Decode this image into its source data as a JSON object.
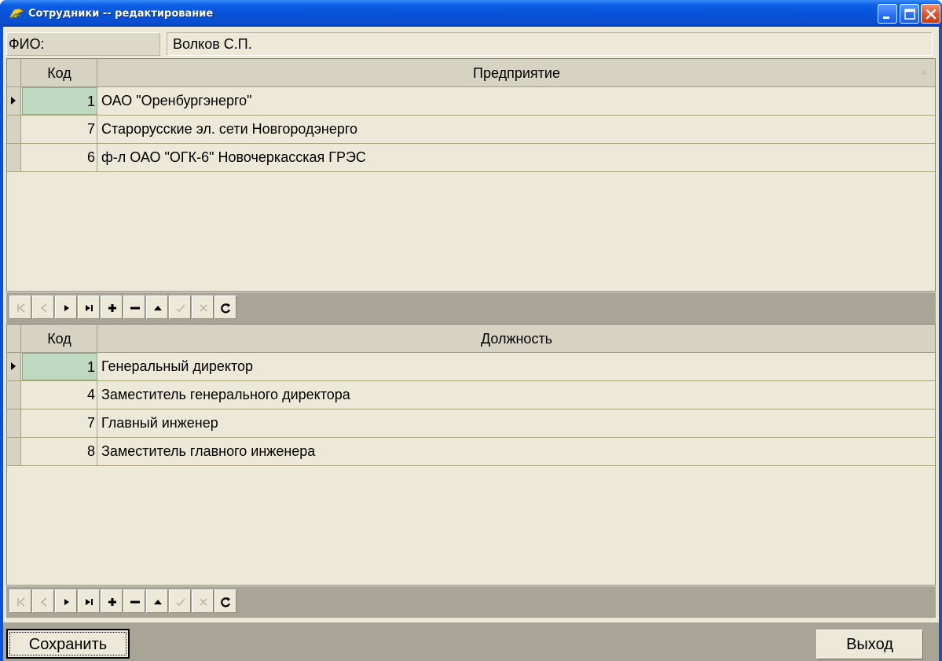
{
  "window": {
    "title": "Сотрудники -- редактирование",
    "colors": {
      "titlebar": "#0853d8",
      "client": "#ece9d8",
      "selected_cell": "#bfd9c0",
      "nav_bar": "#a8a596"
    }
  },
  "fio": {
    "label": "ФИО:",
    "value": "Волков С.П."
  },
  "enterprises": {
    "columns": {
      "code": "Код",
      "name": "Предприятие"
    },
    "rows": [
      {
        "code": "1",
        "name": "ОАО \"Оренбургэнерго\""
      },
      {
        "code": "7",
        "name": "Старорусские эл. сети Новгородэнерго"
      },
      {
        "code": "6",
        "name": "ф-л ОАО \"ОГК-6\" Новочеркасская ГРЭС"
      }
    ],
    "selected_row": 0
  },
  "positions": {
    "columns": {
      "code": "Код",
      "name": "Должность"
    },
    "rows": [
      {
        "code": "1",
        "name": "Генеральный директор"
      },
      {
        "code": "4",
        "name": "Заместитель генерального директора"
      },
      {
        "code": "7",
        "name": "Главный инженер"
      },
      {
        "code": "8",
        "name": "Заместитель главного инженера"
      }
    ],
    "selected_row": 0
  },
  "navigator": {
    "icons": [
      "first-icon",
      "prior-icon",
      "next-icon",
      "last-icon",
      "insert-icon",
      "delete-icon",
      "edit-icon",
      "post-icon",
      "cancel-icon",
      "refresh-icon"
    ]
  },
  "buttons": {
    "save": "Сохранить",
    "exit": "Выход"
  }
}
